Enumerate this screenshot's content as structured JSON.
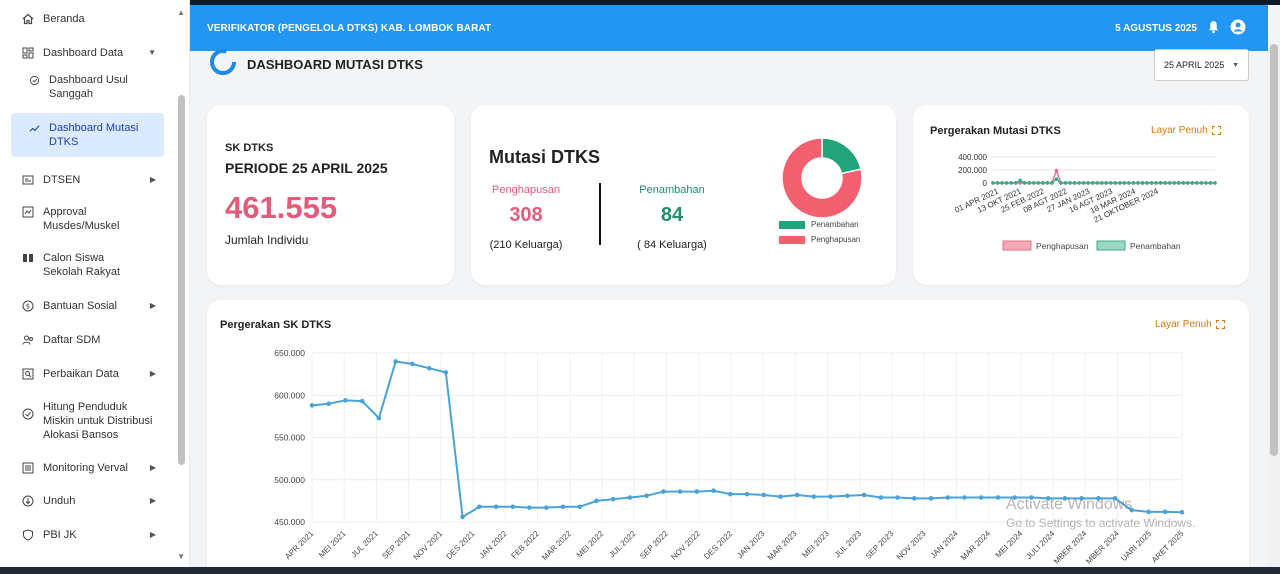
{
  "sidebar": {
    "items": [
      {
        "label": "Beranda",
        "icon": "home-icon"
      },
      {
        "label": "Dashboard Data",
        "icon": "dashboard-icon",
        "caret": "down"
      },
      {
        "label": "Dashboard Usul Sanggah",
        "icon": "check-circle-icon"
      },
      {
        "label": "Dashboard Mutasi DTKS",
        "icon": "trend-icon",
        "active": true
      },
      {
        "label": "DTSEN",
        "icon": "id-card-icon",
        "caret": "right"
      },
      {
        "label": "Approval Musdes/Muskel",
        "icon": "approval-icon"
      },
      {
        "label": "Calon Siswa Sekolah Rakyat",
        "icon": "book-icon"
      },
      {
        "label": "Bantuan Sosial",
        "icon": "dollar-icon",
        "caret": "right"
      },
      {
        "label": "Daftar SDM",
        "icon": "people-icon"
      },
      {
        "label": "Perbaikan Data",
        "icon": "search-doc-icon",
        "caret": "right"
      },
      {
        "label": "Hitung Penduduk Miskin untuk Distribusi Alokasi Bansos",
        "icon": "verified-icon"
      },
      {
        "label": "Monitoring Verval",
        "icon": "list-icon",
        "caret": "right"
      },
      {
        "label": "Unduh",
        "icon": "download-icon",
        "caret": "right"
      },
      {
        "label": "PBI JK",
        "icon": "shield-icon",
        "caret": "right"
      }
    ]
  },
  "header": {
    "title": "VERIFIKATOR (PENGELOLA DTKS) KAB. LOMBOK BARAT",
    "date": "5 AGUSTUS 2025",
    "bell_icon": "bell-icon",
    "account_icon": "account-icon",
    "color": "#2196f3"
  },
  "page": {
    "title": "DASHBOARD MUTASI DTKS",
    "date_select": "25 APRIL 2025"
  },
  "sk_card": {
    "label1": "SK DTKS",
    "label2": "PERIODE 25 APRIL 2025",
    "value": "461.555",
    "sub": "Jumlah Individu"
  },
  "mutasi_card": {
    "title": "Mutasi DTKS",
    "penghapusan_label": "Penghapusan",
    "penghapusan_value": "308",
    "penghapusan_kk": "(210 Keluarga)",
    "penambahan_label": "Penambahan",
    "penambahan_value": "84",
    "penambahan_kk": "( 84 Keluarga)",
    "legend_penambahan": "Penambahan",
    "legend_penghapusan": "Penghapusan",
    "color_penambahan": "#22a37a",
    "color_penghapusan": "#f25f6e"
  },
  "pergerakan_mutasi": {
    "title": "Pergerakan Mutasi DTKS",
    "fullscreen": "Layar Penuh",
    "legend_penghapusan": "Penghapusan",
    "legend_penambahan": "Penambahan"
  },
  "pergerakan_sk": {
    "title": "Pergerakan SK DTKS",
    "fullscreen": "Layar Penuh"
  },
  "watermark": {
    "line1": "Activate Windows",
    "line2": "Go to Settings to activate Windows."
  },
  "chart_data": [
    {
      "type": "pie",
      "categories": [
        "Penambahan",
        "Penghapusan"
      ],
      "values": [
        84,
        308
      ],
      "donut": true
    },
    {
      "type": "line",
      "title": "Pergerakan Mutasi DTKS",
      "x": [
        "01 APR 2021",
        "13 OKT 2021",
        "25 FEB 2022",
        "08 AGT 2022",
        "27 JAN 2023",
        "16 AGT 2023",
        "18 MAR 2024",
        "21 OKTOBER 2024"
      ],
      "yticks": [
        "400.000",
        "200.000",
        "0"
      ],
      "ylim": [
        0,
        400000
      ],
      "series": [
        {
          "name": "Penghapusan",
          "values": [
            1000,
            1000,
            1000,
            1000,
            1000,
            1000,
            1000,
            1000,
            1000,
            1000,
            1000,
            1000,
            1000,
            1000,
            190000,
            1000,
            1000,
            1000,
            1000,
            1000,
            1000,
            1000,
            1000,
            1000,
            1000,
            1000,
            1000,
            1000,
            1000,
            1000,
            1000,
            1000,
            1000,
            1000,
            1000,
            1000,
            1000,
            1000,
            1000,
            1000,
            1000,
            1000,
            1000,
            1000,
            1000,
            1000,
            1000,
            1000,
            1000,
            1000
          ]
        },
        {
          "name": "Penambahan",
          "values": [
            500,
            500,
            500,
            500,
            500,
            500,
            40000,
            500,
            500,
            500,
            500,
            500,
            500,
            500,
            60000,
            500,
            500,
            500,
            500,
            500,
            500,
            500,
            500,
            500,
            500,
            500,
            500,
            500,
            500,
            500,
            500,
            500,
            500,
            500,
            500,
            500,
            500,
            500,
            500,
            500,
            500,
            500,
            500,
            500,
            500,
            500,
            500,
            500,
            500,
            500
          ]
        }
      ],
      "legend": "bottom"
    },
    {
      "type": "line",
      "title": "Pergerakan SK DTKS",
      "yticks": [
        "650.000",
        "600.000",
        "550.000",
        "500.000",
        "450.000"
      ],
      "ylim": [
        450000,
        650000
      ],
      "x": [
        "APR 2021",
        "MEI 2021",
        "JUL 2021",
        "SEP 2021",
        "NOV 2021",
        "DES 2021",
        "JAN 2022",
        "FEB 2022",
        "MAR 2022",
        "MEI 2022",
        "JUL 2022",
        "SEP 2022",
        "NOV 2022",
        "DES 2022",
        "JAN 2023",
        "MAR 2023",
        "MEI 2023",
        "JUL 2023",
        "SEP 2023",
        "NOV 2023",
        "JAN 2024",
        "MAR 2024",
        "MEI 2024",
        "JULI 2024",
        "MBER 2024",
        "MBER 2024",
        "UARI 2025",
        "ARET 2025"
      ],
      "series": [
        {
          "name": "SK DTKS",
          "values": [
            588000,
            590000,
            594000,
            593000,
            573000,
            640000,
            637000,
            632000,
            627000,
            456000,
            468000,
            468000,
            468000,
            467000,
            467000,
            468000,
            468000,
            475000,
            477000,
            479000,
            481000,
            486000,
            486000,
            486000,
            487000,
            483000,
            483000,
            482000,
            480000,
            482000,
            480000,
            480000,
            481000,
            482000,
            479000,
            479000,
            478000,
            478000,
            479000,
            479000,
            479000,
            479000,
            479000,
            479000,
            478000,
            478000,
            478000,
            478000,
            478000,
            464000,
            462000,
            462000,
            461555
          ]
        }
      ],
      "color": "#4aa3d6"
    }
  ]
}
